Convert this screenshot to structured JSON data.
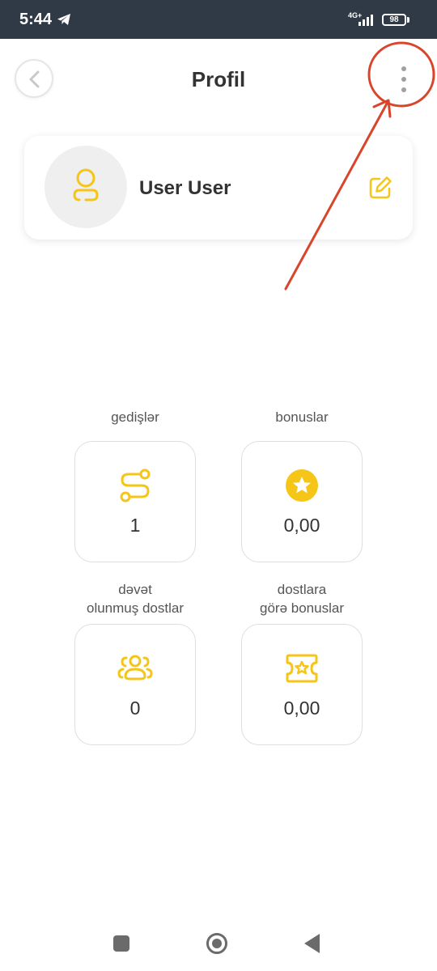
{
  "status_bar": {
    "time": "5:44",
    "network_label": "4G+",
    "battery_level": "98"
  },
  "header": {
    "title": "Profil",
    "back_icon": "chevron-left-icon",
    "menu_icon": "more-vertical-icon"
  },
  "profile": {
    "name": "User User",
    "avatar_icon": "user-icon",
    "edit_icon": "edit-icon"
  },
  "stats": [
    {
      "label": "gedişlər",
      "value": "1",
      "icon": "route-icon"
    },
    {
      "label": "bonuslar",
      "value": "0,00",
      "icon": "star-icon"
    },
    {
      "label": "dəvət\nolunmuş dostlar",
      "value": "0",
      "icon": "users-icon"
    },
    {
      "label": "dostlara\ngörə bonuslar",
      "value": "0,00",
      "icon": "ticket-star-icon"
    }
  ],
  "colors": {
    "accent": "#f5c518",
    "status_bar": "#2f3a46",
    "annotation": "#d9452b"
  },
  "nav_bar": {
    "icons": [
      "recent-apps-icon",
      "home-icon",
      "back-icon"
    ]
  }
}
